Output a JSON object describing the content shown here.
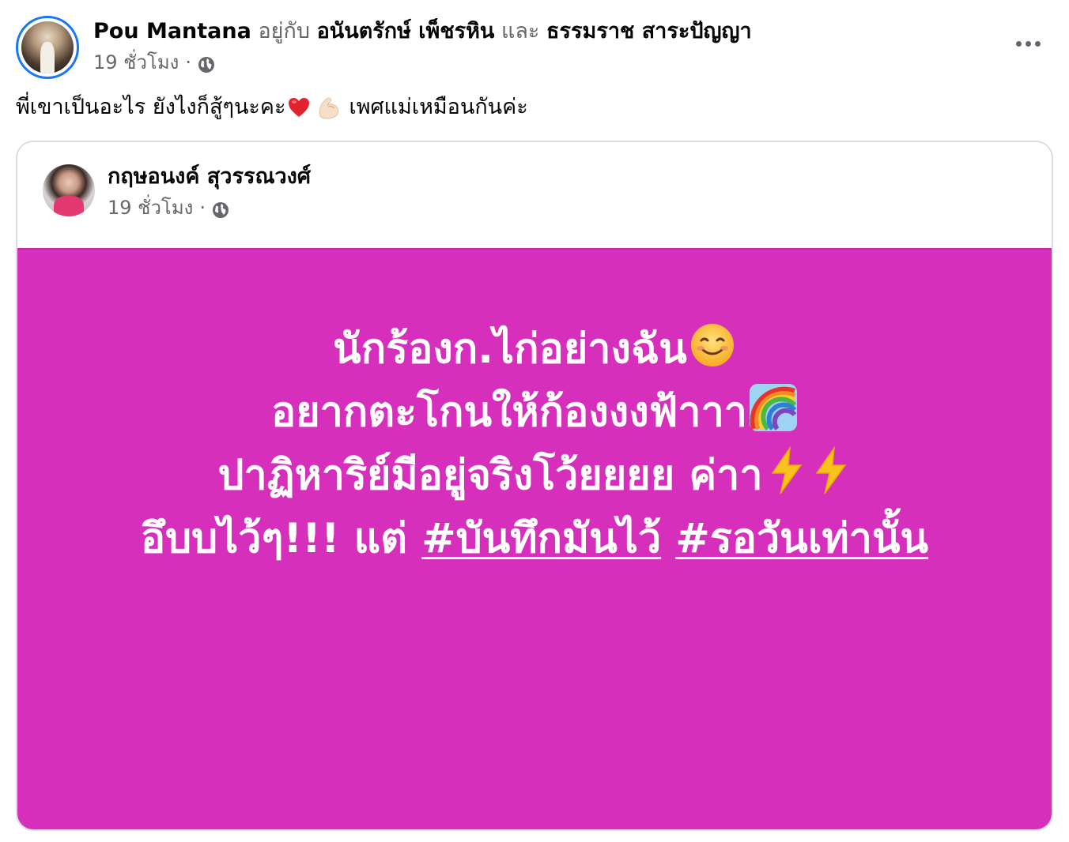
{
  "post": {
    "author": "Pou Mantana",
    "with_text": "อยู่กับ",
    "tagged_1": "อนันตรักษ์ เพ็ชรหิน",
    "and_text": "และ",
    "tagged_2": "ธรรมราช สาระปัญญา",
    "time": "19 ชั่วโมง",
    "separator": "·",
    "audience_icon": "globe-icon",
    "more_icon": "more-options-icon",
    "caption_part1": "พี่เขาเป็นอะไร ยังไงก็สู้ๆนะคะ",
    "caption_emoji_1": "red-heart-emoji",
    "caption_emoji_2": "flexed-biceps-emoji",
    "caption_part2": "เพศแม่เหมือนกันค่ะ"
  },
  "shared_post": {
    "author": "กฤษอนงค์ สุวรรณวงศ์",
    "time": "19 ชั่วโมง",
    "separator": "·",
    "audience_icon": "globe-icon",
    "background_color": "#d62fbb",
    "line1": "นักร้องก.ไก่อย่างฉัน",
    "line1_emoji": "smiling-face-emoji",
    "line2": "อยากตะโกนให้ก้องงงฟ้าาา",
    "line2_emoji": "rainbow-emoji",
    "line3": "ปาฏิหาริย์มีอยู่จริงโว้ยยยย ค่าา",
    "line3_emoji": "high-voltage-emoji",
    "line4_text": "อึบบไว้ๆ!!! แต่ ",
    "hashtag_1": "#บันทึกมันไว้",
    "hashtag_2": "#รอวันเท่านั้น"
  },
  "colors": {
    "link_blue": "#1877f2",
    "muted_text": "#65676b",
    "status_background": "#d62fbb"
  }
}
